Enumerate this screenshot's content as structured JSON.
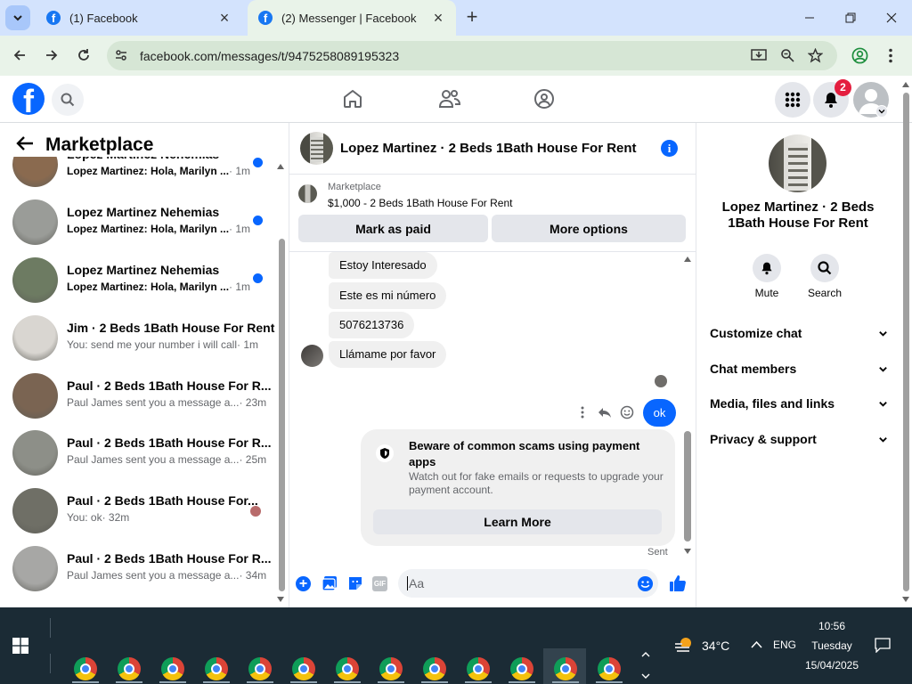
{
  "browser": {
    "tabs": [
      {
        "title": "(1) Facebook"
      },
      {
        "title": "(2) Messenger | Facebook"
      }
    ],
    "url": "facebook.com/messages/t/9475258089195323",
    "new_tab_symbol": "+"
  },
  "fb": {
    "notifications_badge": "2"
  },
  "left": {
    "title": "Marketplace",
    "conversations": [
      {
        "name": "Lopez Martinez Nehemias",
        "preview": "Lopez Martinez: Hola, Marilyn ...",
        "time": "· 1m",
        "unread": true,
        "avatar_color": "#8a6a4f"
      },
      {
        "name": "Lopez Martinez Nehemias",
        "preview": "Lopez Martinez: Hola, Marilyn ...",
        "time": "· 1m",
        "unread": true,
        "avatar_color": "#9a9c98"
      },
      {
        "name": "Lopez Martinez Nehemias",
        "preview": "Lopez Martinez: Hola, Marilyn ...",
        "time": "· 1m",
        "unread": true,
        "avatar_color": "#6d7b62"
      },
      {
        "name": "Jim · 2 Beds 1Bath House For Rent",
        "preview": "You: send me your number i will call",
        "time": "· 1m",
        "unread": false,
        "avatar_color": "#d9d6d1"
      },
      {
        "name": "Paul · 2 Beds 1Bath House For R...",
        "preview": "Paul James sent you a message a...",
        "time": "· 23m",
        "unread": false,
        "avatar_color": "#7a6452"
      },
      {
        "name": "Paul · 2 Beds 1Bath House For R...",
        "preview": "Paul James sent you a message a...",
        "time": "· 25m",
        "unread": false,
        "avatar_color": "#8d8f88"
      },
      {
        "name": "Paul · 2 Beds 1Bath House For...",
        "preview": "You: ok",
        "time": "· 32m",
        "unread": false,
        "avatar_color": "#6f6f66"
      },
      {
        "name": "Paul · 2 Beds 1Bath House For R...",
        "preview": "Paul James sent you a message a...",
        "time": "· 34m",
        "unread": false,
        "avatar_color": "#a7a7a5"
      }
    ]
  },
  "chat": {
    "header_title": "Lopez Martinez · 2 Beds 1Bath House For Rent",
    "listing_source": "Marketplace",
    "listing_summary": "$1,000 - 2 Beds 1Bath House For Rent",
    "mark_paid_label": "Mark as paid",
    "more_options_label": "More options",
    "messages": [
      {
        "text": "Estoy Interesado"
      },
      {
        "text": "Este es mi número"
      },
      {
        "text": "5076213736"
      },
      {
        "text": "Llámame por favor"
      }
    ],
    "my_message": "ok",
    "notice_title": "Beware of common scams using payment apps",
    "notice_body": "Watch out for fake emails or requests to upgrade your payment account.",
    "notice_button": "Learn More",
    "status": "Sent",
    "composer_placeholder": "Aa",
    "gif_label": "GIF"
  },
  "info": {
    "title": "Lopez Martinez · 2 Beds 1Bath House For Rent",
    "mute_label": "Mute",
    "search_label": "Search",
    "sections": [
      {
        "label": "Customize chat"
      },
      {
        "label": "Chat members"
      },
      {
        "label": "Media, files and links"
      },
      {
        "label": "Privacy & support"
      }
    ]
  },
  "taskbar": {
    "weather": "34°C",
    "language": "ENG",
    "time": "10:56",
    "day": "Tuesday",
    "date": "15/04/2025",
    "app_count": 13
  }
}
